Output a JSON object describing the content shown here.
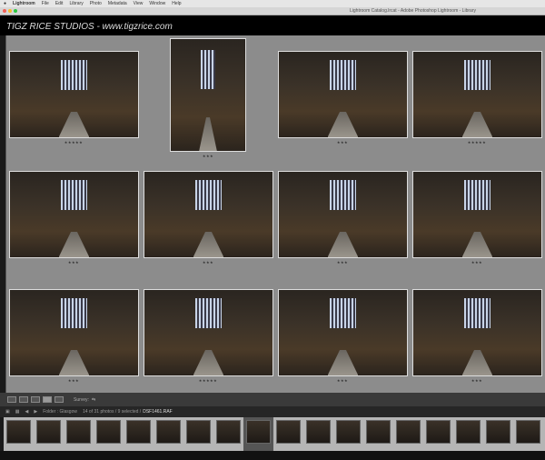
{
  "menubar": {
    "items": [
      "Lightroom",
      "File",
      "Edit",
      "Library",
      "Photo",
      "Metadata",
      "View",
      "Window",
      "Help"
    ]
  },
  "window": {
    "title": "Lightroom Catalog.lrcat - Adobe Photoshop Lightroom - Library"
  },
  "identity_plate": "TIGZ RICE STUDIOS - www.tigzrice.com",
  "grid": {
    "photos": [
      {
        "orientation": "landscape",
        "rating": "★★★★★"
      },
      {
        "orientation": "portrait",
        "rating": "★★★"
      },
      {
        "orientation": "landscape",
        "rating": "★★★"
      },
      {
        "orientation": "landscape",
        "rating": "★★★★★"
      },
      {
        "orientation": "landscape",
        "rating": "★★★"
      },
      {
        "orientation": "landscape",
        "rating": "★★★"
      },
      {
        "orientation": "landscape",
        "rating": "★★★"
      },
      {
        "orientation": "landscape",
        "rating": "★★★"
      },
      {
        "orientation": "landscape",
        "rating": "★★★"
      },
      {
        "orientation": "landscape",
        "rating": "★★★★★"
      },
      {
        "orientation": "landscape",
        "rating": "★★★"
      },
      {
        "orientation": "landscape",
        "rating": "★★★"
      }
    ]
  },
  "toolbar": {
    "sort_label": "Survey:"
  },
  "filmstrip_header": {
    "source": "Folder : Glasgow",
    "count": "14 of 31 photos / 9 selected /",
    "filename": "DSF1461.RAF"
  },
  "filmstrip": {
    "count": 18,
    "selected_index": 8
  }
}
